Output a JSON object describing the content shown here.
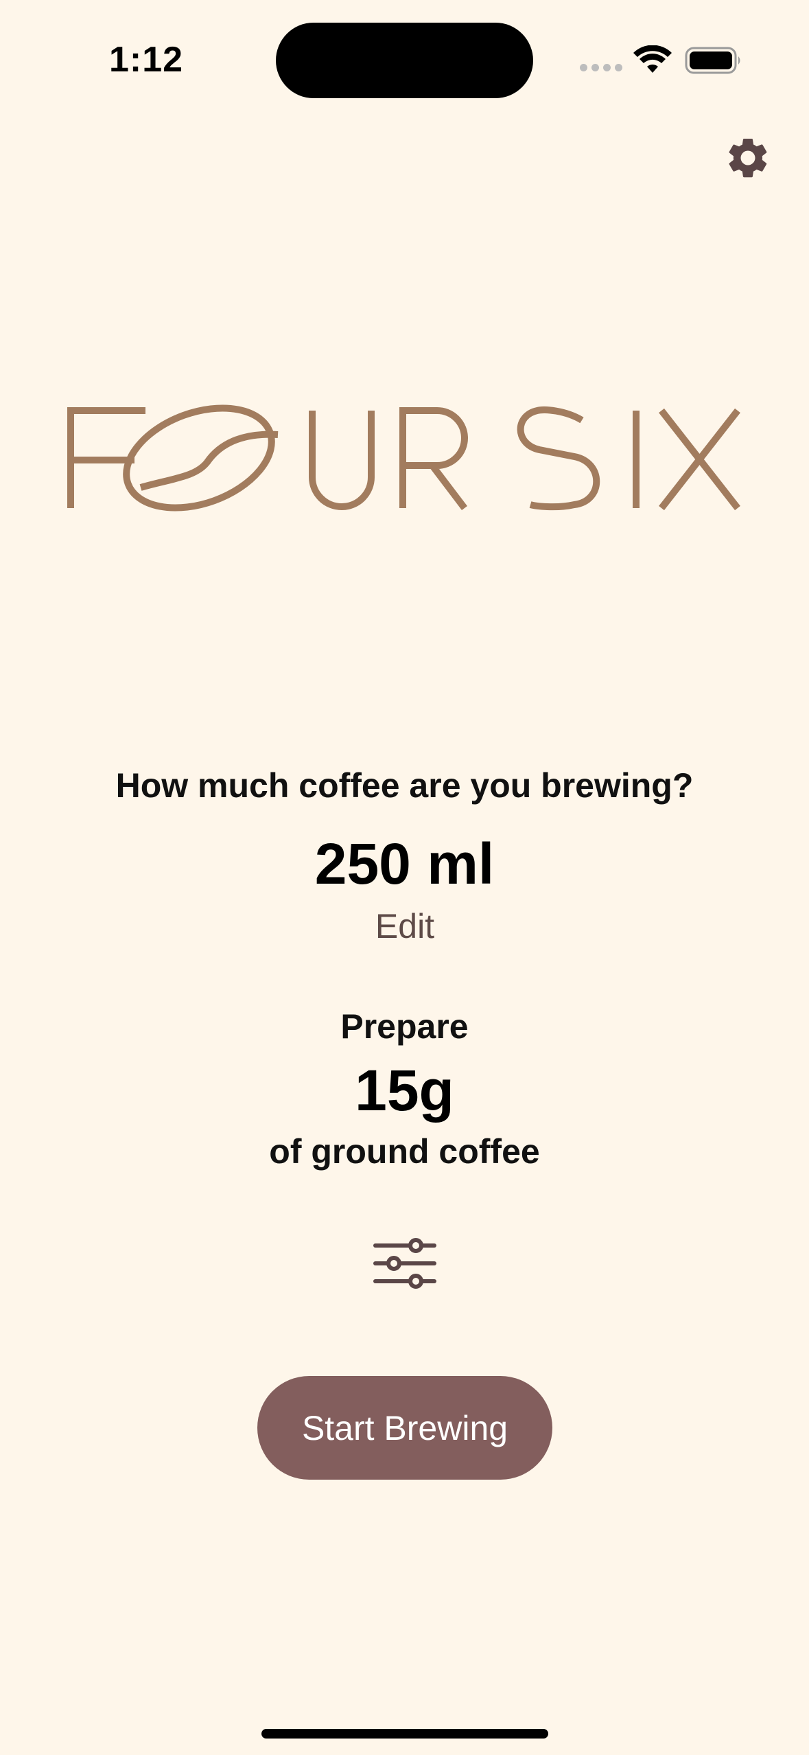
{
  "status_bar": {
    "time": "1:12"
  },
  "icons": {
    "settings": "gear-icon",
    "adjust": "sliders-icon",
    "wifi": "wifi-icon",
    "battery": "battery-icon"
  },
  "logo": {
    "text": "FOUR SIX",
    "color": "#A27C5E"
  },
  "main": {
    "question": "How much coffee are you brewing?",
    "volume": "250 ml",
    "edit_label": "Edit",
    "prepare_label": "Prepare",
    "grams": "15g",
    "grams_suffix": "of ground coffee",
    "start_label": "Start Brewing"
  },
  "colors": {
    "background": "#FEF6EA",
    "accent": "#835E5D",
    "logo": "#A27C5E",
    "icon": "#5A4647"
  }
}
